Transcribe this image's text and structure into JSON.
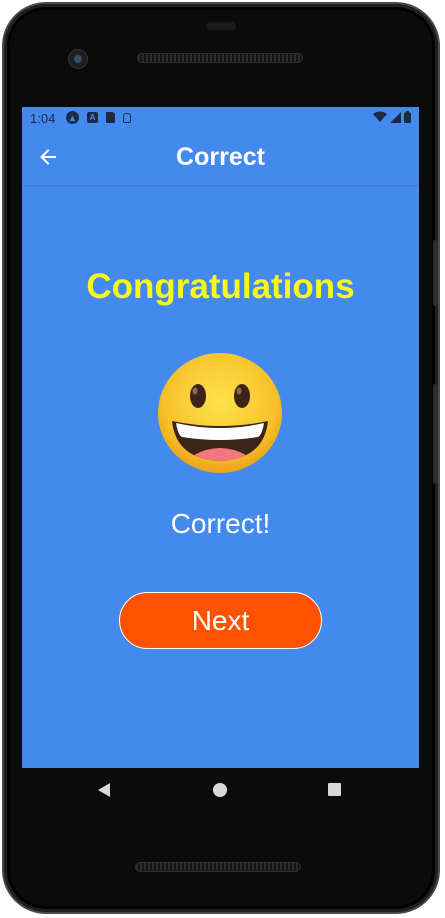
{
  "status_bar": {
    "time": "1:04",
    "left_icons": [
      "android-studio-icon",
      "a-icon",
      "sd-card-icon",
      "notification-outline-icon"
    ],
    "right_icons": [
      "wifi-icon",
      "cellular-signal-icon",
      "battery-icon"
    ]
  },
  "app_bar": {
    "title": "Correct",
    "back_icon": "arrow-back-icon"
  },
  "main": {
    "heading": "Congratulations",
    "emoji": "grinning-face-icon",
    "message": "Correct!",
    "next_label": "Next"
  },
  "navigation_bar": {
    "back": "nav-back-icon",
    "home": "nav-home-icon",
    "recents": "nav-recents-icon"
  },
  "colors": {
    "background": "#448aee",
    "heading": "#f8f81a",
    "button": "#ff5200",
    "text": "#ffffff"
  }
}
